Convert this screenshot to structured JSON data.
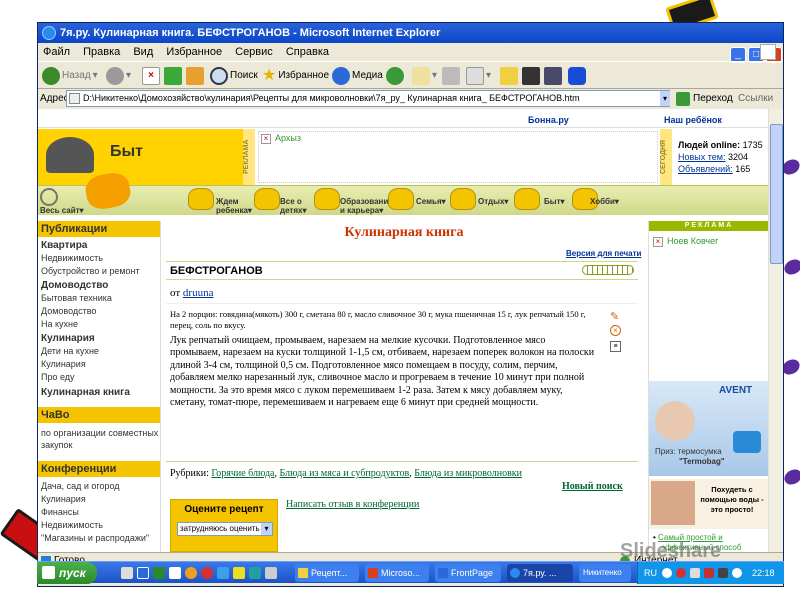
{
  "window": {
    "title": "7я.ру. Кулинарная книга. БЕФСТРОГАНОВ - Microsoft Internet Explorer",
    "controls": [
      "_",
      "□",
      "×"
    ]
  },
  "menu": [
    "Файл",
    "Правка",
    "Вид",
    "Избранное",
    "Сервис",
    "Справка"
  ],
  "toolbar": {
    "back": "Назад",
    "search": "Поиск",
    "favorites": "Избранное",
    "media": "Медиа"
  },
  "address": {
    "label": "Адрес:",
    "url": "D:\\Никитенко\\Домохозяйство\\кулинария\\Рецепты для микроволновки\\7я_ру_ Кулинарная книга_ БЕФСТРОГАНОВ.htm",
    "go": "Переход",
    "links": "Ссылки"
  },
  "site": {
    "top_links": [
      "Бонна.ру",
      "Наш ребёнок"
    ],
    "section": "Быт",
    "banner_vertical": "РЕКЛАМА",
    "banner_link": "Архыз",
    "today_vertical": "СЕГОДНЯ",
    "stats": [
      {
        "label": "Людей online:",
        "value": "1735"
      },
      {
        "label": "Новых тем:",
        "value": "3204"
      },
      {
        "label": "Объявлений:",
        "value": "165"
      }
    ],
    "nav": [
      {
        "label": "Весь сайт"
      },
      {
        "label": "Ждем ребенка"
      },
      {
        "label": "Все о детях"
      },
      {
        "label": "Образование и карьера"
      },
      {
        "label": "Семья"
      },
      {
        "label": "Отдых"
      },
      {
        "label": "Быт"
      },
      {
        "label": "Хобби"
      }
    ]
  },
  "left": {
    "sections": [
      {
        "head": "Публикации",
        "groups": [
          {
            "title": "Квартира",
            "items": [
              "Недвижимость",
              "Обустройство и ремонт"
            ]
          },
          {
            "title": "Домоводство",
            "items": [
              "Бытовая техника",
              "Домоводство",
              "На кухне"
            ]
          },
          {
            "title": "Кулинария",
            "items": [
              "Дети на кухне",
              "Кулинария",
              "Про еду"
            ]
          },
          {
            "title": "Кулинарная книга",
            "items": []
          }
        ]
      },
      {
        "head": "ЧаВо",
        "groups": [
          {
            "title": "",
            "items": [
              "по организации совместных закупок"
            ]
          }
        ]
      },
      {
        "head": "Конференции",
        "groups": [
          {
            "title": "",
            "items": [
              "Дача, сад и огород",
              "Кулинария",
              "Финансы",
              "Недвижимость",
              "\"Магазины и распродажи\""
            ]
          }
        ]
      }
    ]
  },
  "recipe": {
    "book_title": "Кулинарная книга",
    "print_link": "Версия для печати",
    "name": "БЕФСТРОГАНОВ",
    "author_prefix": "от",
    "author": "druuna",
    "ingredients": "На 2 порции: говядина(мякоть) 300 г, сметана 80 г, масло сливочное 30 г, мука пшеничная 15 г, лук репчатый 150 г, перец, соль по вкусу.",
    "text": "Лук репчатый очищаем, промываем, нарезаем на мелкие кусочки. Подготовленное мясо промываем, нарезаем на куски толщиной 1-1,5 см, отбиваем, нарезаем поперек волокон на полоски длиной 3-4 см, толщиной 0,5 см. Подготовленное мясо помещаем в посуду, солим, перчим, добавляем мелко нарезанный лук, сливочное масло и прогреваем в течение 10 минут при полной мощности. За это время мясо с луком перемешиваем 1-2 раза. Затем к мясу добавляем муку, сметану, томат-пюре, перемешиваем и нагреваем еще 6 минут при средней мощности.",
    "rubrics_label": "Рубрики:",
    "rubrics": [
      "Горячие блюда",
      "Блюда из мяса и субпродуктов",
      "Блюда из микроволновки"
    ],
    "new_search": "Новый поиск",
    "rate_title": "Оцените рецепт",
    "rate_select": "затрудняюсь оценить",
    "review_link": "Написать отзыв в конференции"
  },
  "right": {
    "ad_head": "РЕКЛАМА",
    "ad_link": "Ноев Ковчег",
    "brand": "AVENT",
    "prize_line1": "Приз: термосумка",
    "prize_line2": "\"Termobag\"",
    "promo": "Похудеть с помощью воды - это просто!",
    "promo_link1": "Самый простой и",
    "promo_link2": "эффективный способ"
  },
  "status": {
    "left": "Готово",
    "zone": "Интернет"
  },
  "taskbar": {
    "start": "пуск",
    "tasks": [
      "Рецепт...",
      "Microso...",
      "FrontPage",
      "7я.ру. ...",
      "Никитенко"
    ],
    "lang": "RU",
    "clock": "22:18"
  },
  "watermark": "Slideshare",
  "colors": {
    "accent_yellow": "#f5c400",
    "link_blue": "#003399",
    "title_red": "#cc3300",
    "xp_blue": "#0a46c8",
    "start_green": "#3a9a2a"
  }
}
